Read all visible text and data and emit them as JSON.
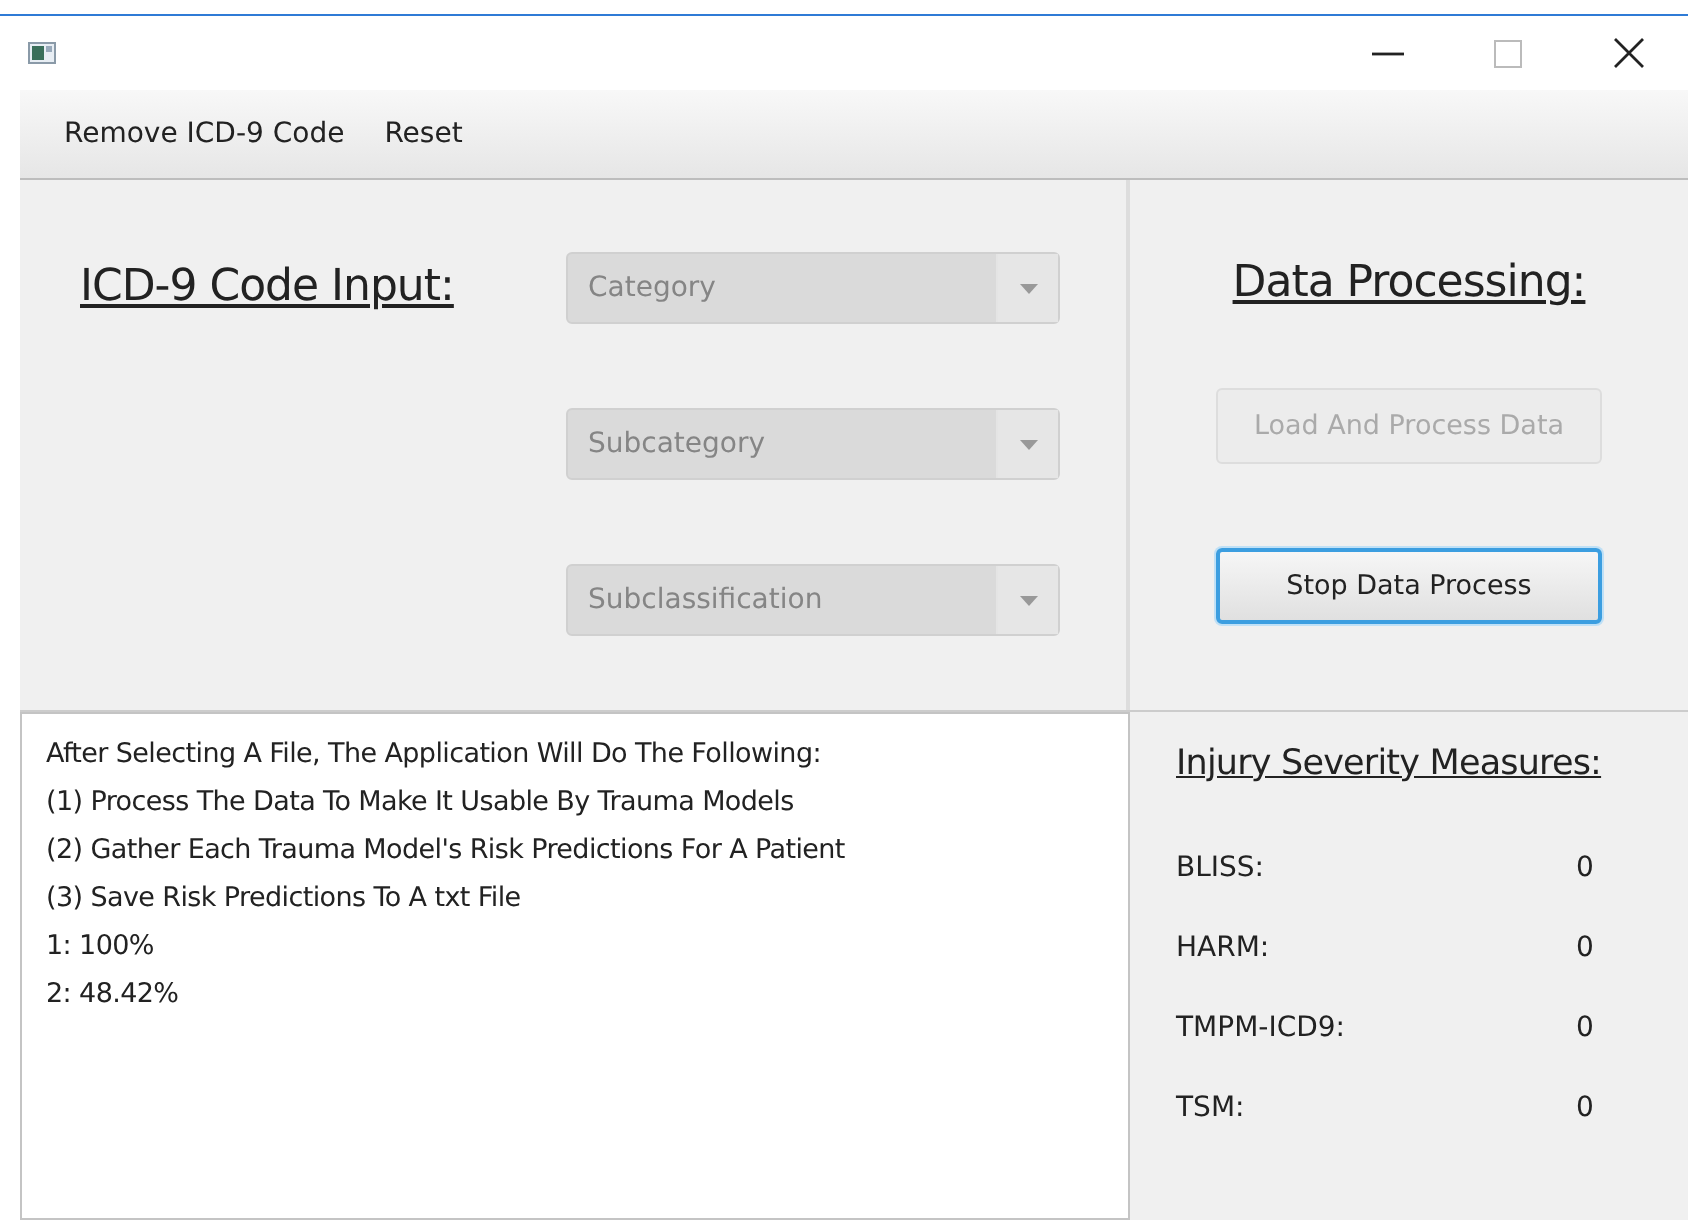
{
  "menu": [
    {
      "label": "Remove ICD-9 Code"
    },
    {
      "label": "Reset"
    }
  ],
  "input_section": {
    "title": "ICD-9 Code Input:",
    "dropdowns": [
      {
        "placeholder": "Category",
        "disabled": true
      },
      {
        "placeholder": "Subcategory",
        "disabled": true
      },
      {
        "placeholder": "Subclassification",
        "disabled": true
      }
    ]
  },
  "processing": {
    "title": "Data Processing:",
    "buttons": [
      {
        "label": "Load And Process Data",
        "disabled": true,
        "focused": false
      },
      {
        "label": "Stop Data Process",
        "disabled": false,
        "focused": true
      }
    ]
  },
  "log": {
    "lines": [
      "After Selecting A File, The Application Will Do The Following:",
      "(1) Process The Data To Make It Usable By Trauma Models",
      "(2) Gather Each Trauma Model's Risk Predictions For A Patient",
      "(3) Save Risk Predictions To A txt File",
      "1: 100%",
      "2: 48.42%"
    ]
  },
  "measures": {
    "title": "Injury Severity Measures:",
    "rows": [
      {
        "label": "BLISS:",
        "value": "0"
      },
      {
        "label": "HARM:",
        "value": "0"
      },
      {
        "label": "TMPM-ICD9:",
        "value": "0"
      },
      {
        "label": "TSM:",
        "value": "0"
      }
    ]
  }
}
